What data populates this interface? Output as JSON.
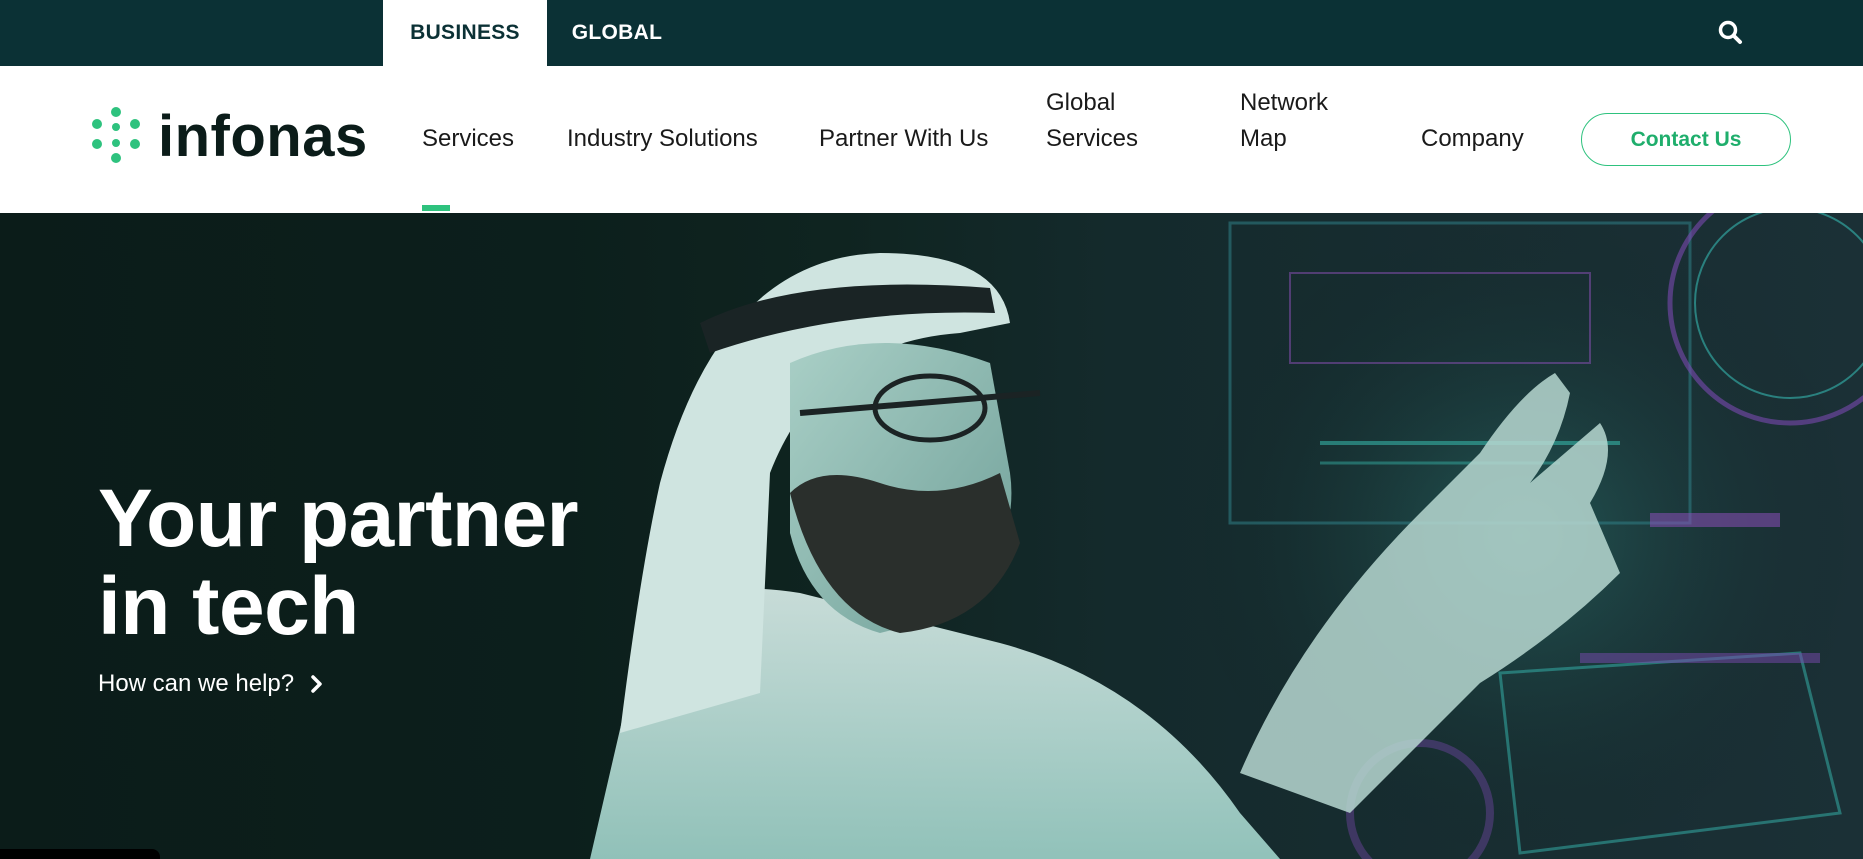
{
  "topbar": {
    "tabs": [
      {
        "label": "BUSINESS",
        "active": true
      },
      {
        "label": "GLOBAL",
        "active": false
      }
    ],
    "search_icon": "search-icon"
  },
  "nav": {
    "logo_text": "infonas",
    "items": [
      {
        "label": "Services",
        "active": true
      },
      {
        "label": "Industry Solutions"
      },
      {
        "label": "Partner With Us"
      },
      {
        "label_line1": "Global",
        "label_line2": "Services"
      },
      {
        "label_line1": "Network",
        "label_line2": "Map"
      },
      {
        "label": "Company"
      }
    ],
    "contact_label": "Contact Us"
  },
  "hero": {
    "title_line1": "Your partner",
    "title_line2": "in tech",
    "cta_label": "How can we help?"
  },
  "colors": {
    "topbar_bg": "#0b3135",
    "accent_green": "#2ec27e",
    "hero_bg": "#0b1c19"
  }
}
